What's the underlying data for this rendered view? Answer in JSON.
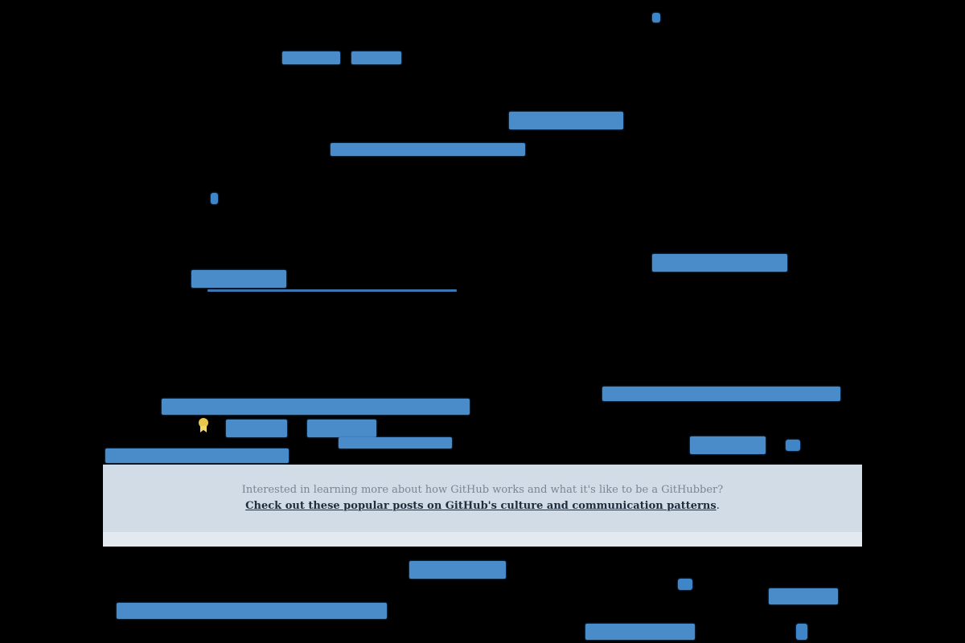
{
  "notice": {
    "intro": "Interested in learning more about how GitHub works and what it's like to be a GitHubber?",
    "link": "Check out these popular posts on GitHub's culture and communication patterns",
    "period": "."
  },
  "colors": {
    "background": "#000000",
    "link_highlight": "#4a8cc9",
    "notice_background": "#d2dce7"
  },
  "icons": [
    "award-icon"
  ]
}
